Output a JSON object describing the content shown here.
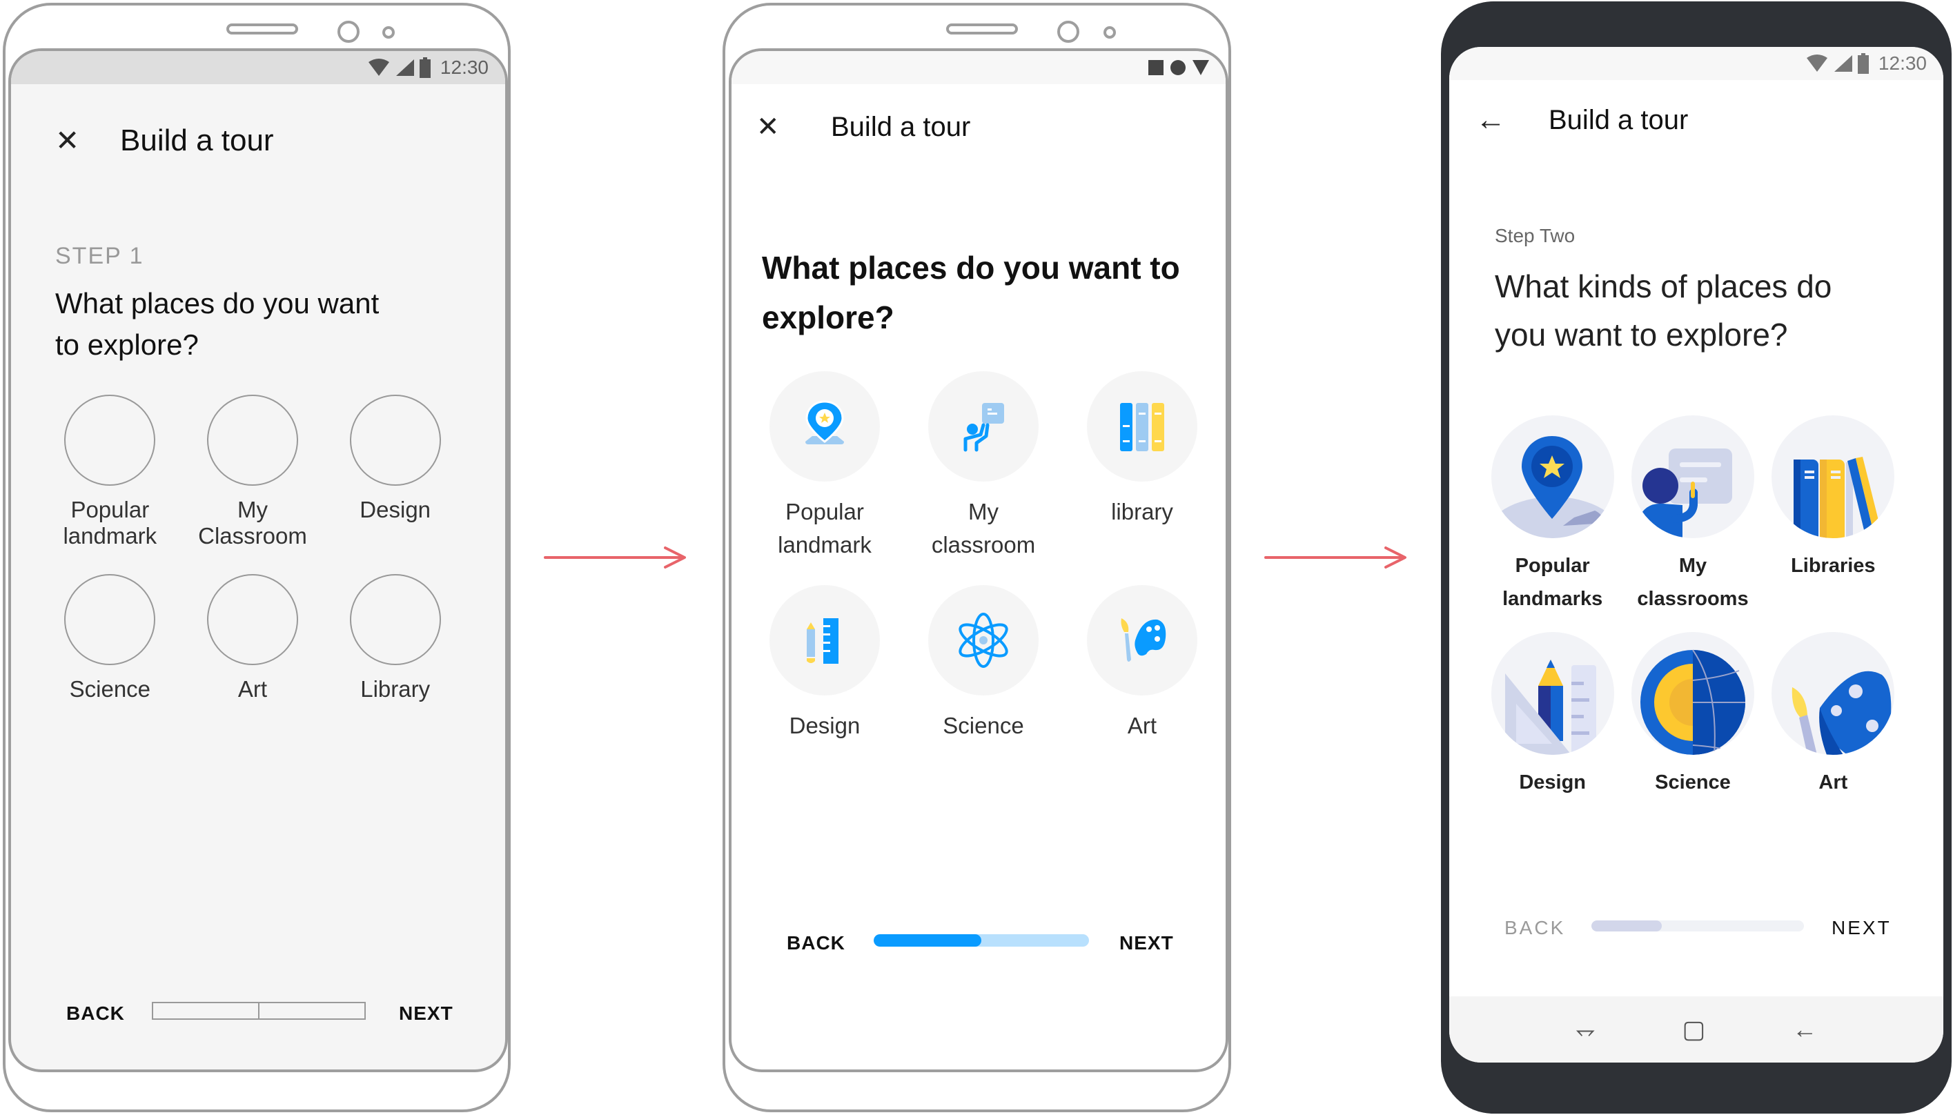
{
  "status": {
    "time": "12:30"
  },
  "flow_arrows": {
    "color": "#e8646a"
  },
  "phone1": {
    "variant": "low-fidelity wireframe",
    "title": "Build a tour",
    "nav_icon": "close-icon",
    "step": "STEP 1",
    "question_line1": "What places do you want",
    "question_line2": "to explore?",
    "tiles": [
      {
        "line1": "Popular",
        "line2": "landmark"
      },
      {
        "line1": "My",
        "line2": "Classroom"
      },
      {
        "line1": "Design",
        "line2": ""
      },
      {
        "line1": "Science",
        "line2": ""
      },
      {
        "line1": "Art",
        "line2": ""
      },
      {
        "line1": "Library",
        "line2": ""
      }
    ],
    "back": "BACK",
    "next": "NEXT",
    "progress_segments": 2
  },
  "phone2": {
    "variant": "mid-fidelity",
    "title": "Build a tour",
    "nav_icon": "close-icon",
    "question_line1": "What places do you want to",
    "question_line2": "explore?",
    "tiles": [
      {
        "line1": "Popular",
        "line2": "landmark",
        "icon": "map-pin-star-icon"
      },
      {
        "line1": "My",
        "line2": "classroom",
        "icon": "teacher-board-icon"
      },
      {
        "line1": "library",
        "line2": "",
        "icon": "books-icon"
      },
      {
        "line1": "Design",
        "line2": "",
        "icon": "pencil-ruler-icon"
      },
      {
        "line1": "Science",
        "line2": "",
        "icon": "atom-icon"
      },
      {
        "line1": "Art",
        "line2": "",
        "icon": "palette-icon"
      }
    ],
    "back": "BACK",
    "next": "NEXT",
    "progress": 0.5,
    "colors": {
      "primary": "#0a9bff",
      "track": "#b8e0fd",
      "accent": "#ffd84d",
      "light": "#9ecbf2"
    }
  },
  "phone3": {
    "variant": "high-fidelity",
    "title": "Build a tour",
    "nav_icon": "back-arrow-icon",
    "step": "Step Two",
    "question_line1": "What kinds of places do",
    "question_line2": "you want to explore?",
    "tiles": [
      {
        "line1": "Popular",
        "line2": "landmarks",
        "icon": "map-pin-star-icon"
      },
      {
        "line1": "My",
        "line2": "classrooms",
        "icon": "teacher-board-icon"
      },
      {
        "line1": "Libraries",
        "line2": "",
        "icon": "books-icon"
      },
      {
        "line1": "Design",
        "line2": "",
        "icon": "pencil-ruler-icon"
      },
      {
        "line1": "Science",
        "line2": "",
        "icon": "globe-icon"
      },
      {
        "line1": "Art",
        "line2": "",
        "icon": "palette-icon"
      }
    ],
    "back": "BACK",
    "next": "NEXT",
    "progress": 0.33,
    "colors": {
      "primary": "#1565d0",
      "dark": "#0a4aaf",
      "navy": "#253592",
      "yellow": "#fdc82f",
      "lavender": "#cfd5ea",
      "track": "#f0f2f6",
      "fill": "#d2d6ea"
    },
    "system_nav": [
      "recents-icon",
      "home-icon",
      "back-icon"
    ]
  }
}
